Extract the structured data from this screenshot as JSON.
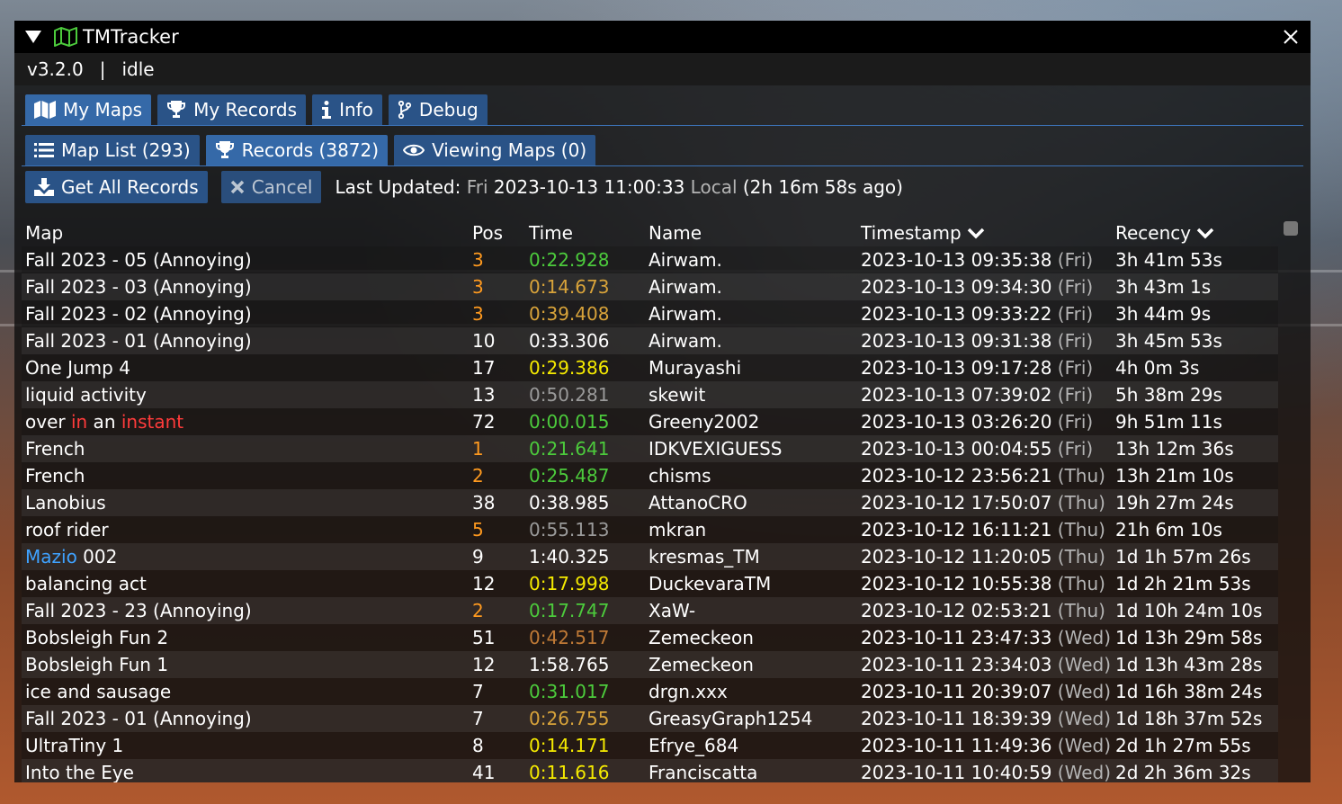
{
  "window": {
    "title": "TMTracker"
  },
  "status": {
    "version": "v3.2.0",
    "separator": "|",
    "state": "idle"
  },
  "main_tabs": [
    {
      "label": "My Maps",
      "icon": "map-icon",
      "active": true
    },
    {
      "label": "My Records",
      "icon": "trophy-icon",
      "active": false
    },
    {
      "label": "Info",
      "icon": "info-icon",
      "active": false
    },
    {
      "label": "Debug",
      "icon": "code-branch-icon",
      "active": false
    }
  ],
  "sub_tabs": [
    {
      "label": "Map List (293)",
      "icon": "list-icon",
      "active": false
    },
    {
      "label": "Records (3872)",
      "icon": "trophy-icon",
      "active": true
    },
    {
      "label": "Viewing Maps (0)",
      "icon": "eye-icon",
      "active": false
    }
  ],
  "toolbar": {
    "get_all_label": "Get All Records",
    "cancel_label": "Cancel",
    "last_updated_label": "Last Updated:",
    "day": "Fri",
    "datetime": "2023-10-13 11:00:33",
    "local_label": "Local",
    "ago": "(2h 16m 58s ago)"
  },
  "table": {
    "headers": {
      "map": "Map",
      "pos": "Pos",
      "time": "Time",
      "name": "Name",
      "timestamp": "Timestamp",
      "recency": "Recency"
    },
    "rows": [
      {
        "map": [
          {
            "t": "Fall 2023 - 05 (Annoying)",
            "c": "white"
          }
        ],
        "pos": "3",
        "pos_c": "orange",
        "time": "0:22.928",
        "time_c": "green",
        "name": "Airwam.",
        "ts": "2023-10-13 09:35:38",
        "day": "(Fri)",
        "rec": "3h 41m 53s"
      },
      {
        "map": [
          {
            "t": "Fall 2023 - 03 (Annoying)",
            "c": "white"
          }
        ],
        "pos": "3",
        "pos_c": "orange",
        "time": "0:14.673",
        "time_c": "gold",
        "name": "Airwam.",
        "ts": "2023-10-13 09:34:30",
        "day": "(Fri)",
        "rec": "3h 43m 1s"
      },
      {
        "map": [
          {
            "t": "Fall 2023 - 02 (Annoying)",
            "c": "white"
          }
        ],
        "pos": "3",
        "pos_c": "orange",
        "time": "0:39.408",
        "time_c": "gold",
        "name": "Airwam.",
        "ts": "2023-10-13 09:33:22",
        "day": "(Fri)",
        "rec": "3h 44m 9s"
      },
      {
        "map": [
          {
            "t": "Fall 2023 - 01 (Annoying)",
            "c": "white"
          }
        ],
        "pos": "10",
        "pos_c": "white",
        "time": "0:33.306",
        "time_c": "white",
        "name": "Airwam.",
        "ts": "2023-10-13 09:31:38",
        "day": "(Fri)",
        "rec": "3h 45m 53s"
      },
      {
        "map": [
          {
            "t": "One Jump 4",
            "c": "white"
          }
        ],
        "pos": "17",
        "pos_c": "white",
        "time": "0:29.386",
        "time_c": "yellow",
        "name": "Murayashi",
        "ts": "2023-10-13 09:17:28",
        "day": "(Fri)",
        "rec": "4h 0m 3s"
      },
      {
        "map": [
          {
            "t": "liquid activity",
            "c": "white"
          }
        ],
        "pos": "13",
        "pos_c": "white",
        "time": "0:50.281",
        "time_c": "silver",
        "name": "skewit",
        "ts": "2023-10-13 07:39:02",
        "day": "(Fri)",
        "rec": "5h 38m 29s"
      },
      {
        "map": [
          {
            "t": "over ",
            "c": "white"
          },
          {
            "t": "in",
            "c": "red"
          },
          {
            "t": " an ",
            "c": "white"
          },
          {
            "t": "instant",
            "c": "red"
          }
        ],
        "pos": "72",
        "pos_c": "white",
        "time": "0:00.015",
        "time_c": "green",
        "name": "Greeny2002",
        "ts": "2023-10-13 03:26:20",
        "day": "(Fri)",
        "rec": "9h 51m 11s"
      },
      {
        "map": [
          {
            "t": "French",
            "c": "white"
          }
        ],
        "pos": "1",
        "pos_c": "orange",
        "time": "0:21.641",
        "time_c": "green",
        "name": "IDKVEXIGUESS",
        "ts": "2023-10-13 00:04:55",
        "day": "(Fri)",
        "rec": "13h 12m 36s"
      },
      {
        "map": [
          {
            "t": "French",
            "c": "white"
          }
        ],
        "pos": "2",
        "pos_c": "orange",
        "time": "0:25.487",
        "time_c": "green",
        "name": "chisms",
        "ts": "2023-10-12 23:56:21",
        "day": "(Thu)",
        "rec": "13h 21m 10s"
      },
      {
        "map": [
          {
            "t": "Lanobius",
            "c": "white"
          }
        ],
        "pos": "38",
        "pos_c": "white",
        "time": "0:38.985",
        "time_c": "white",
        "name": "AttanoCRO",
        "ts": "2023-10-12 17:50:07",
        "day": "(Thu)",
        "rec": "19h 27m 24s"
      },
      {
        "map": [
          {
            "t": "roof rider",
            "c": "white"
          }
        ],
        "pos": "5",
        "pos_c": "orange",
        "time": "0:55.113",
        "time_c": "silver",
        "name": "mkran",
        "ts": "2023-10-12 16:11:21",
        "day": "(Thu)",
        "rec": "21h 6m 10s"
      },
      {
        "map": [
          {
            "t": "Mazio",
            "c": "blue"
          },
          {
            "t": " 002",
            "c": "white"
          }
        ],
        "pos": "9",
        "pos_c": "white",
        "time": "1:40.325",
        "time_c": "white",
        "name": "kresmas_TM",
        "ts": "2023-10-12 11:20:05",
        "day": "(Thu)",
        "rec": "1d 1h 57m 26s"
      },
      {
        "map": [
          {
            "t": "balancing act",
            "c": "white"
          }
        ],
        "pos": "12",
        "pos_c": "white",
        "time": "0:17.998",
        "time_c": "yellow",
        "name": "DuckevaraTM",
        "ts": "2023-10-12 10:55:38",
        "day": "(Thu)",
        "rec": "1d 2h 21m 53s"
      },
      {
        "map": [
          {
            "t": "Fall 2023 - 23 (Annoying)",
            "c": "white"
          }
        ],
        "pos": "2",
        "pos_c": "orange",
        "time": "0:17.747",
        "time_c": "green",
        "name": "XaW-",
        "ts": "2023-10-12 02:53:21",
        "day": "(Thu)",
        "rec": "1d 10h 24m 10s"
      },
      {
        "map": [
          {
            "t": "Bobsleigh Fun 2",
            "c": "white"
          }
        ],
        "pos": "51",
        "pos_c": "white",
        "time": "0:42.517",
        "time_c": "bronze",
        "name": "Zemeckeon",
        "ts": "2023-10-11 23:47:33",
        "day": "(Wed)",
        "rec": "1d 13h 29m 58s"
      },
      {
        "map": [
          {
            "t": "Bobsleigh Fun 1",
            "c": "white"
          }
        ],
        "pos": "12",
        "pos_c": "white",
        "time": "1:58.765",
        "time_c": "white",
        "name": "Zemeckeon",
        "ts": "2023-10-11 23:34:03",
        "day": "(Wed)",
        "rec": "1d 13h 43m 28s"
      },
      {
        "map": [
          {
            "t": "ice and sausage",
            "c": "white"
          }
        ],
        "pos": "7",
        "pos_c": "white",
        "time": "0:31.017",
        "time_c": "green",
        "name": "drgn.xxx",
        "ts": "2023-10-11 20:39:07",
        "day": "(Wed)",
        "rec": "1d 16h 38m 24s"
      },
      {
        "map": [
          {
            "t": "Fall 2023 - 01 (Annoying)",
            "c": "white"
          }
        ],
        "pos": "7",
        "pos_c": "white",
        "time": "0:26.755",
        "time_c": "gold",
        "name": "GreasyGraph1254",
        "ts": "2023-10-11 18:39:39",
        "day": "(Wed)",
        "rec": "1d 18h 37m 52s"
      },
      {
        "map": [
          {
            "t": "UltraTiny 1",
            "c": "white"
          }
        ],
        "pos": "8",
        "pos_c": "white",
        "time": "0:14.171",
        "time_c": "yellow",
        "name": "Efrye_684",
        "ts": "2023-10-11 11:49:36",
        "day": "(Wed)",
        "rec": "2d 1h 27m 55s"
      },
      {
        "map": [
          {
            "t": "Into the Eye",
            "c": "white"
          }
        ],
        "pos": "41",
        "pos_c": "white",
        "time": "0:11.616",
        "time_c": "yellow",
        "name": "Franciscatta",
        "ts": "2023-10-11 10:40:59",
        "day": "(Wed)",
        "rec": "2d 2h 36m 32s"
      }
    ]
  }
}
